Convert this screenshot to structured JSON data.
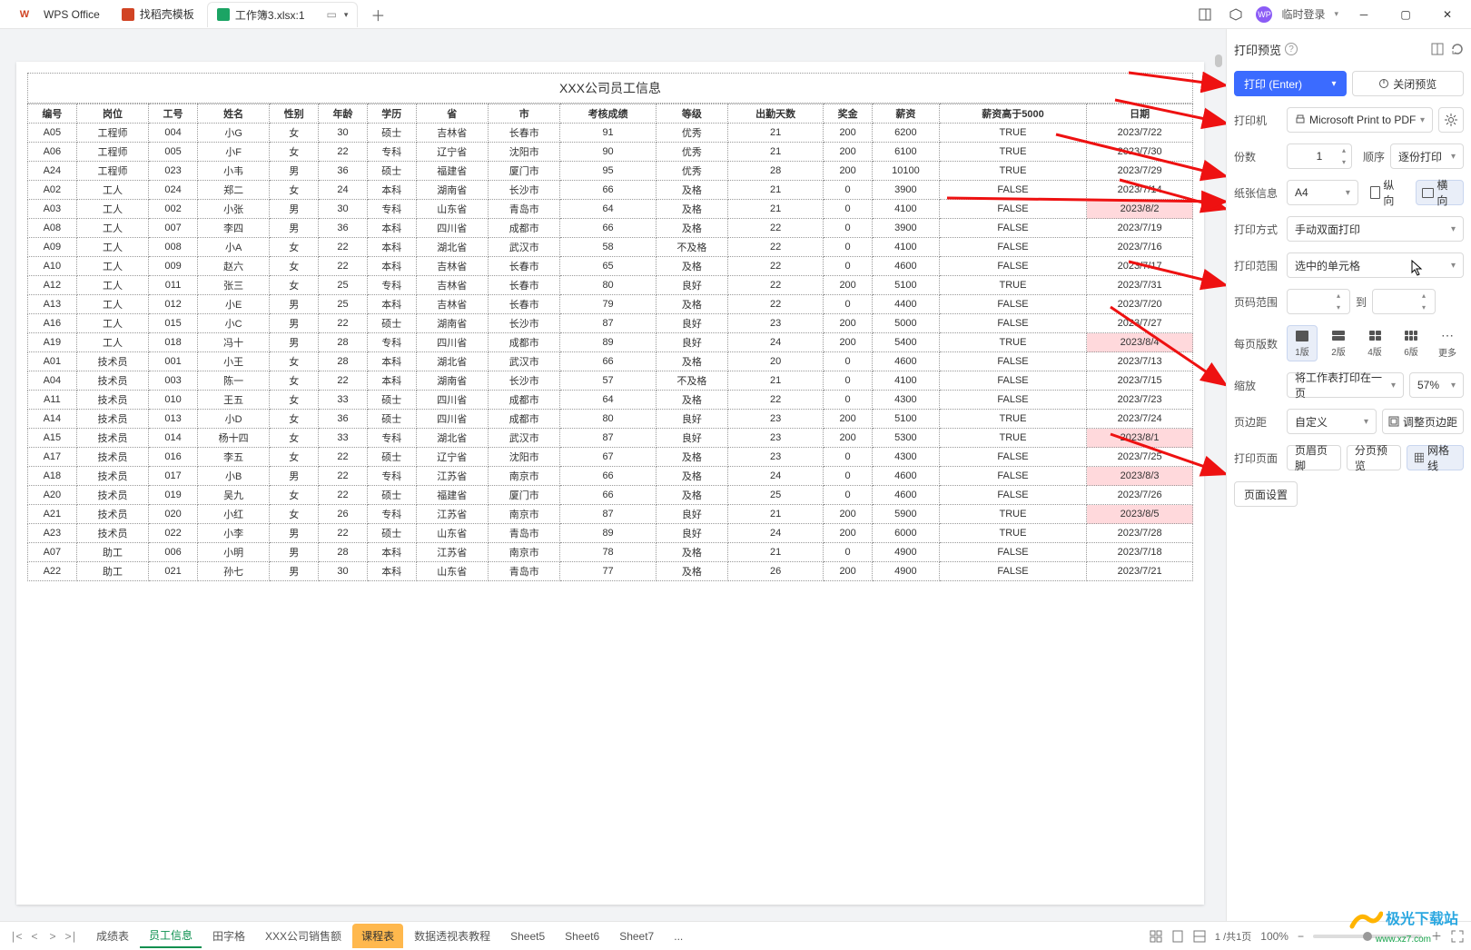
{
  "titlebar": {
    "app": "WPS Office",
    "tab_template": "找稻壳模板",
    "tab_file": "工作簿3.xlsx:1",
    "login": "临时登录"
  },
  "preview": {
    "title": "XXX公司员工信息",
    "headers": [
      "编号",
      "岗位",
      "工号",
      "姓名",
      "性别",
      "年龄",
      "学历",
      "省",
      "市",
      "考核成绩",
      "等级",
      "出勤天数",
      "奖金",
      "薪资",
      "薪资高于5000",
      "日期"
    ],
    "rows": [
      [
        "A05",
        "工程师",
        "004",
        "小G",
        "女",
        "30",
        "硕士",
        "吉林省",
        "长春市",
        "91",
        "优秀",
        "21",
        "200",
        "6200",
        "TRUE",
        "2023/7/22",
        ""
      ],
      [
        "A06",
        "工程师",
        "005",
        "小F",
        "女",
        "22",
        "专科",
        "辽宁省",
        "沈阳市",
        "90",
        "优秀",
        "21",
        "200",
        "6100",
        "TRUE",
        "2023/7/30",
        ""
      ],
      [
        "A24",
        "工程师",
        "023",
        "小韦",
        "男",
        "36",
        "硕士",
        "福建省",
        "厦门市",
        "95",
        "优秀",
        "28",
        "200",
        "10100",
        "TRUE",
        "2023/7/29",
        ""
      ],
      [
        "A02",
        "工人",
        "024",
        "郑二",
        "女",
        "24",
        "本科",
        "湖南省",
        "长沙市",
        "66",
        "及格",
        "21",
        "0",
        "3900",
        "FALSE",
        "2023/7/14",
        ""
      ],
      [
        "A03",
        "工人",
        "002",
        "小张",
        "男",
        "30",
        "专科",
        "山东省",
        "青岛市",
        "64",
        "及格",
        "21",
        "0",
        "4100",
        "FALSE",
        "2023/8/2",
        "hl"
      ],
      [
        "A08",
        "工人",
        "007",
        "李四",
        "男",
        "36",
        "本科",
        "四川省",
        "成都市",
        "66",
        "及格",
        "22",
        "0",
        "3900",
        "FALSE",
        "2023/7/19",
        ""
      ],
      [
        "A09",
        "工人",
        "008",
        "小A",
        "女",
        "22",
        "本科",
        "湖北省",
        "武汉市",
        "58",
        "不及格",
        "22",
        "0",
        "4100",
        "FALSE",
        "2023/7/16",
        ""
      ],
      [
        "A10",
        "工人",
        "009",
        "赵六",
        "女",
        "22",
        "本科",
        "吉林省",
        "长春市",
        "65",
        "及格",
        "22",
        "0",
        "4600",
        "FALSE",
        "2023/7/17",
        ""
      ],
      [
        "A12",
        "工人",
        "011",
        "张三",
        "女",
        "25",
        "专科",
        "吉林省",
        "长春市",
        "80",
        "良好",
        "22",
        "200",
        "5100",
        "TRUE",
        "2023/7/31",
        ""
      ],
      [
        "A13",
        "工人",
        "012",
        "小E",
        "男",
        "25",
        "本科",
        "吉林省",
        "长春市",
        "79",
        "及格",
        "22",
        "0",
        "4400",
        "FALSE",
        "2023/7/20",
        ""
      ],
      [
        "A16",
        "工人",
        "015",
        "小C",
        "男",
        "22",
        "硕士",
        "湖南省",
        "长沙市",
        "87",
        "良好",
        "23",
        "200",
        "5000",
        "FALSE",
        "2023/7/27",
        ""
      ],
      [
        "A19",
        "工人",
        "018",
        "冯十",
        "男",
        "28",
        "专科",
        "四川省",
        "成都市",
        "89",
        "良好",
        "24",
        "200",
        "5400",
        "TRUE",
        "2023/8/4",
        "hl"
      ],
      [
        "A01",
        "技术员",
        "001",
        "小王",
        "女",
        "28",
        "本科",
        "湖北省",
        "武汉市",
        "66",
        "及格",
        "20",
        "0",
        "4600",
        "FALSE",
        "2023/7/13",
        ""
      ],
      [
        "A04",
        "技术员",
        "003",
        "陈一",
        "女",
        "22",
        "本科",
        "湖南省",
        "长沙市",
        "57",
        "不及格",
        "21",
        "0",
        "4100",
        "FALSE",
        "2023/7/15",
        ""
      ],
      [
        "A11",
        "技术员",
        "010",
        "王五",
        "女",
        "33",
        "硕士",
        "四川省",
        "成都市",
        "64",
        "及格",
        "22",
        "0",
        "4300",
        "FALSE",
        "2023/7/23",
        ""
      ],
      [
        "A14",
        "技术员",
        "013",
        "小D",
        "女",
        "36",
        "硕士",
        "四川省",
        "成都市",
        "80",
        "良好",
        "23",
        "200",
        "5100",
        "TRUE",
        "2023/7/24",
        ""
      ],
      [
        "A15",
        "技术员",
        "014",
        "杨十四",
        "女",
        "33",
        "专科",
        "湖北省",
        "武汉市",
        "87",
        "良好",
        "23",
        "200",
        "5300",
        "TRUE",
        "2023/8/1",
        "hl"
      ],
      [
        "A17",
        "技术员",
        "016",
        "李五",
        "女",
        "22",
        "硕士",
        "辽宁省",
        "沈阳市",
        "67",
        "及格",
        "23",
        "0",
        "4300",
        "FALSE",
        "2023/7/25",
        ""
      ],
      [
        "A18",
        "技术员",
        "017",
        "小B",
        "男",
        "22",
        "专科",
        "江苏省",
        "南京市",
        "66",
        "及格",
        "24",
        "0",
        "4600",
        "FALSE",
        "2023/8/3",
        "hl"
      ],
      [
        "A20",
        "技术员",
        "019",
        "吴九",
        "女",
        "22",
        "硕士",
        "福建省",
        "厦门市",
        "66",
        "及格",
        "25",
        "0",
        "4600",
        "FALSE",
        "2023/7/26",
        ""
      ],
      [
        "A21",
        "技术员",
        "020",
        "小红",
        "女",
        "26",
        "专科",
        "江苏省",
        "南京市",
        "87",
        "良好",
        "21",
        "200",
        "5900",
        "TRUE",
        "2023/8/5",
        "hl"
      ],
      [
        "A23",
        "技术员",
        "022",
        "小李",
        "男",
        "22",
        "硕士",
        "山东省",
        "青岛市",
        "89",
        "良好",
        "24",
        "200",
        "6000",
        "TRUE",
        "2023/7/28",
        ""
      ],
      [
        "A07",
        "助工",
        "006",
        "小明",
        "男",
        "28",
        "本科",
        "江苏省",
        "南京市",
        "78",
        "及格",
        "21",
        "0",
        "4900",
        "FALSE",
        "2023/7/18",
        ""
      ],
      [
        "A22",
        "助工",
        "021",
        "孙七",
        "男",
        "30",
        "本科",
        "山东省",
        "青岛市",
        "77",
        "及格",
        "26",
        "200",
        "4900",
        "FALSE",
        "2023/7/21",
        ""
      ]
    ]
  },
  "panel": {
    "title": "打印预览",
    "print_btn": "打印 (Enter)",
    "close_btn": "关闭预览",
    "printer_label": "打印机",
    "printer_value": "Microsoft Print to PDF",
    "copies_label": "份数",
    "copies_value": "1",
    "order_label": "顺序",
    "order_value": "逐份打印",
    "paper_label": "纸张信息",
    "paper_value": "A4",
    "portrait": "纵向",
    "landscape": "横向",
    "mode_label": "打印方式",
    "mode_value": "手动双面打印",
    "range_label": "打印范围",
    "range_value": "选中的单元格",
    "page_range_label": "页码范围",
    "page_range_to": "到",
    "per_page_label": "每页版数",
    "layout_1": "1版",
    "layout_2": "2版",
    "layout_4": "4版",
    "layout_6": "6版",
    "layout_more": "更多",
    "zoom_label": "缩放",
    "zoom_value": "将工作表打印在一页",
    "zoom_pct": "57%",
    "margin_label": "页边距",
    "margin_value": "自定义",
    "margin_adjust": "调整页边距",
    "print_page_label": "打印页面",
    "header_footer": "页眉页脚",
    "page_break": "分页预览",
    "gridlines": "网格线",
    "page_setup_btn": "页面设置"
  },
  "sheetbar": {
    "tabs": [
      "成绩表",
      "员工信息",
      "田字格",
      "XXX公司销售额",
      "课程表",
      "数据透视表教程",
      "Sheet5",
      "Sheet6",
      "Sheet7",
      "..."
    ],
    "active_index": 1,
    "orange_index": 4,
    "page_ind": "1 /共1页",
    "zoom": "100%"
  },
  "watermark": {
    "cn": "极光下载站",
    "en": "www.xz7.com"
  }
}
